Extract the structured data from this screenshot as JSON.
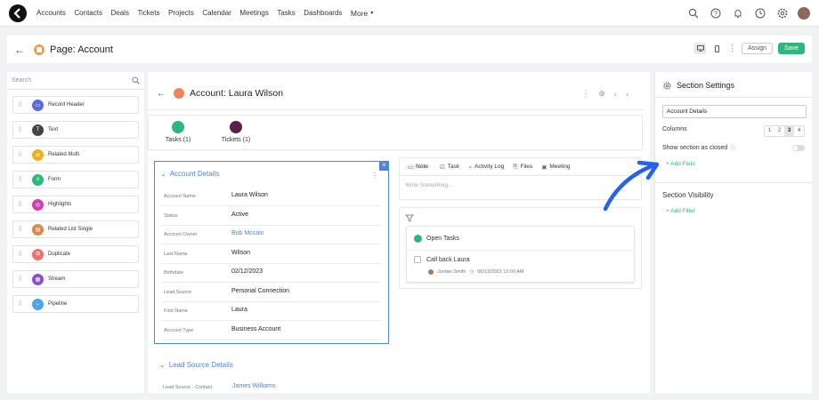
{
  "nav": {
    "items": [
      "Accounts",
      "Contacts",
      "Deals",
      "Tickets",
      "Projects",
      "Calendar",
      "Meetings",
      "Tasks",
      "Dashboards"
    ],
    "more_label": "More",
    "icons": [
      "search-icon",
      "help-icon",
      "bell-icon",
      "clock-icon",
      "gear-icon",
      "user-avatar"
    ]
  },
  "page": {
    "title": "Page: Account",
    "assign_label": "Assign",
    "save_label": "Save"
  },
  "left": {
    "search_placeholder": "Search",
    "widgets": [
      {
        "label": "Record Header",
        "color": "#5b6bd6"
      },
      {
        "label": "Text",
        "color": "#444444"
      },
      {
        "label": "Related Multi",
        "color": "#e8b022"
      },
      {
        "label": "Form",
        "color": "#2eb77d"
      },
      {
        "label": "Highlights",
        "color": "#d03fb0"
      },
      {
        "label": "Related List Single",
        "color": "#e0864a"
      },
      {
        "label": "Duplicate",
        "color": "#f06e6e"
      },
      {
        "label": "Stream",
        "color": "#8a4fd8"
      },
      {
        "label": "Pipeline",
        "color": "#4fa3e8"
      }
    ]
  },
  "record": {
    "title": "Account: Laura Wilson",
    "tabs": [
      {
        "label": "Tasks (1)",
        "color": "#2eb77d"
      },
      {
        "label": "Tickets (1)",
        "color": "#5a1f4a"
      }
    ],
    "section_title": "Account Details",
    "fields": [
      {
        "label": "Account Name",
        "value": "Laura Wilson",
        "link": false
      },
      {
        "label": "Status",
        "value": "Active",
        "link": false
      },
      {
        "label": "Account Owner",
        "value": "Bob Mccain",
        "link": true
      },
      {
        "label": "Last Name",
        "value": "Wilson",
        "link": false
      },
      {
        "label": "Birthdate",
        "value": "02/12/2023",
        "link": false
      },
      {
        "label": "Lead Source",
        "value": "Personal Connection",
        "link": false
      },
      {
        "label": "First Name",
        "value": "Laura",
        "link": false
      },
      {
        "label": "Account Type",
        "value": "Business Account",
        "link": false
      }
    ],
    "lead_section_title": "Lead Source Details",
    "lead_field": {
      "label": "Lead Source - Contact",
      "value": "James Williams"
    }
  },
  "activity": {
    "tabs": [
      "Note",
      "Task",
      "Activity Log",
      "Files",
      "Meeting"
    ],
    "placeholder": "Write Something...",
    "open_tasks_title": "Open Tasks",
    "task_title": "Call back Laura",
    "task_owner": "Jordan Smith",
    "task_date": "06/13/2023 10:00 AM"
  },
  "settings": {
    "title": "Section Settings",
    "section_name": "Account Details",
    "columns_label": "Columns",
    "column_options": [
      "1",
      "2",
      "3",
      "4"
    ],
    "selected_column": "3",
    "show_closed_label": "Show section as closed",
    "add_field_label": "+ Add Field",
    "visibility_label": "Section Visibility",
    "add_filter_label": "+ Add Filter"
  },
  "colors": {
    "accent": "#4e84d9",
    "save": "#2eb77d",
    "annotation_arrow": "#2563eb"
  }
}
